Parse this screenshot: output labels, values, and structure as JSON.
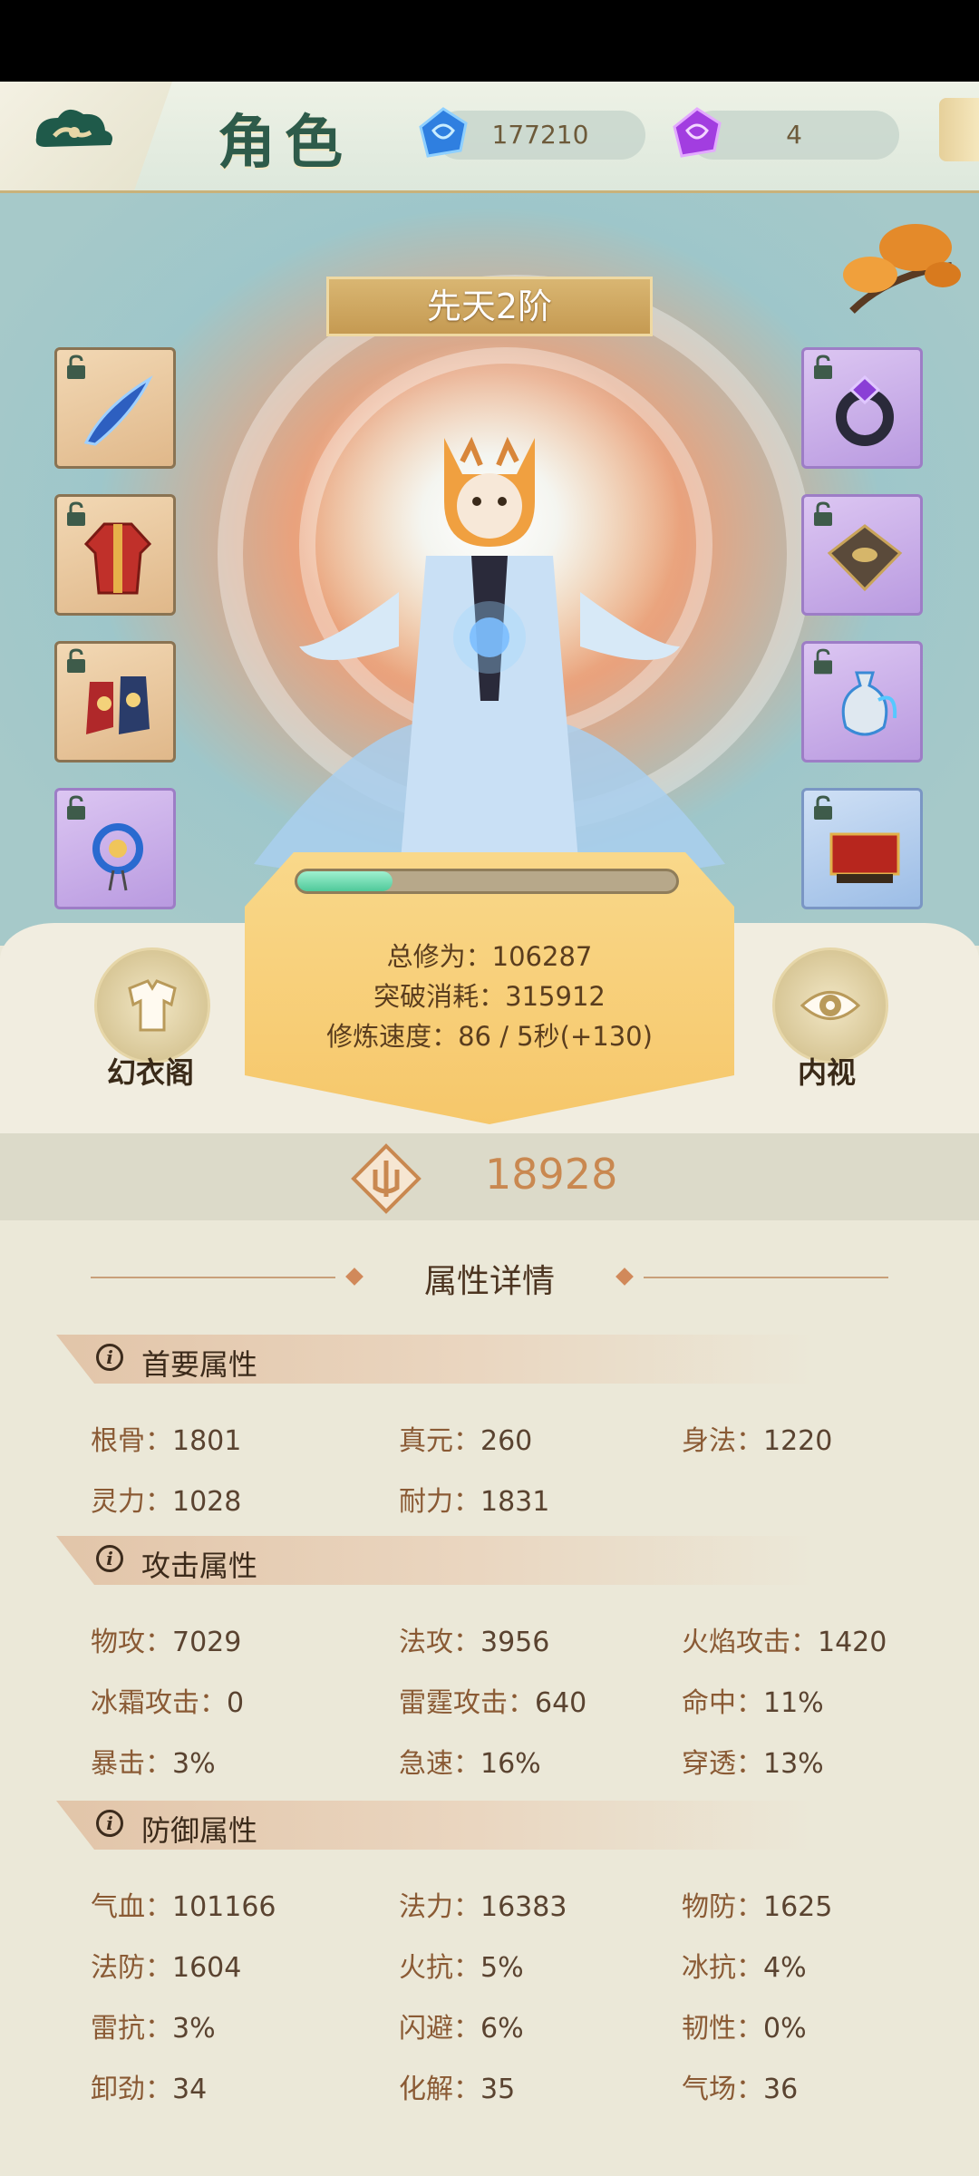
{
  "header": {
    "title": "角色",
    "currency_blue": "177210",
    "currency_purple": "4"
  },
  "scene": {
    "rank": "先天2阶",
    "cultivation_progress": 0.25
  },
  "cultivation": {
    "total_label": "总修为：",
    "total_value": "106287",
    "breakthrough_label": "突破消耗：",
    "breakthrough_value": "315912",
    "speed_label": "修炼速度：",
    "speed_value": "86 / 5秒(+130)"
  },
  "buttons": {
    "wardrobe": "幻衣阁",
    "inner_view": "内视"
  },
  "power": {
    "value": "18928"
  },
  "attributes": {
    "section_title": "属性详情",
    "primary": {
      "title": "首要属性",
      "items": [
        {
          "k": "根骨：",
          "v": "1801"
        },
        {
          "k": "真元：",
          "v": "260"
        },
        {
          "k": "身法：",
          "v": "1220"
        },
        {
          "k": "灵力：",
          "v": "1028"
        },
        {
          "k": "耐力：",
          "v": "1831"
        }
      ]
    },
    "attack": {
      "title": "攻击属性",
      "items": [
        {
          "k": "物攻：",
          "v": "7029"
        },
        {
          "k": "法攻：",
          "v": "3956"
        },
        {
          "k": "火焰攻击：",
          "v": "1420"
        },
        {
          "k": "冰霜攻击：",
          "v": "0"
        },
        {
          "k": "雷霆攻击：",
          "v": "640"
        },
        {
          "k": "命中：",
          "v": "11%"
        },
        {
          "k": "暴击：",
          "v": "3%"
        },
        {
          "k": "急速：",
          "v": "16%"
        },
        {
          "k": "穿透：",
          "v": "13%"
        }
      ]
    },
    "defense": {
      "title": "防御属性",
      "items": [
        {
          "k": "气血：",
          "v": "101166"
        },
        {
          "k": "法力：",
          "v": "16383"
        },
        {
          "k": "物防：",
          "v": "1625"
        },
        {
          "k": "法防：",
          "v": "1604"
        },
        {
          "k": "火抗：",
          "v": "5%"
        },
        {
          "k": "冰抗：",
          "v": "4%"
        },
        {
          "k": "雷抗：",
          "v": "3%"
        },
        {
          "k": "闪避：",
          "v": "6%"
        },
        {
          "k": "韧性：",
          "v": "0%"
        },
        {
          "k": "卸劲：",
          "v": "34"
        },
        {
          "k": "化解：",
          "v": "35"
        },
        {
          "k": "气场：",
          "v": "36"
        }
      ]
    }
  },
  "equipment": {
    "left": [
      "blade-icon",
      "robe-icon",
      "boots-icon",
      "pendant-icon"
    ],
    "right": [
      "ring-icon",
      "talisman-icon",
      "vase-icon",
      "book-icon"
    ]
  }
}
